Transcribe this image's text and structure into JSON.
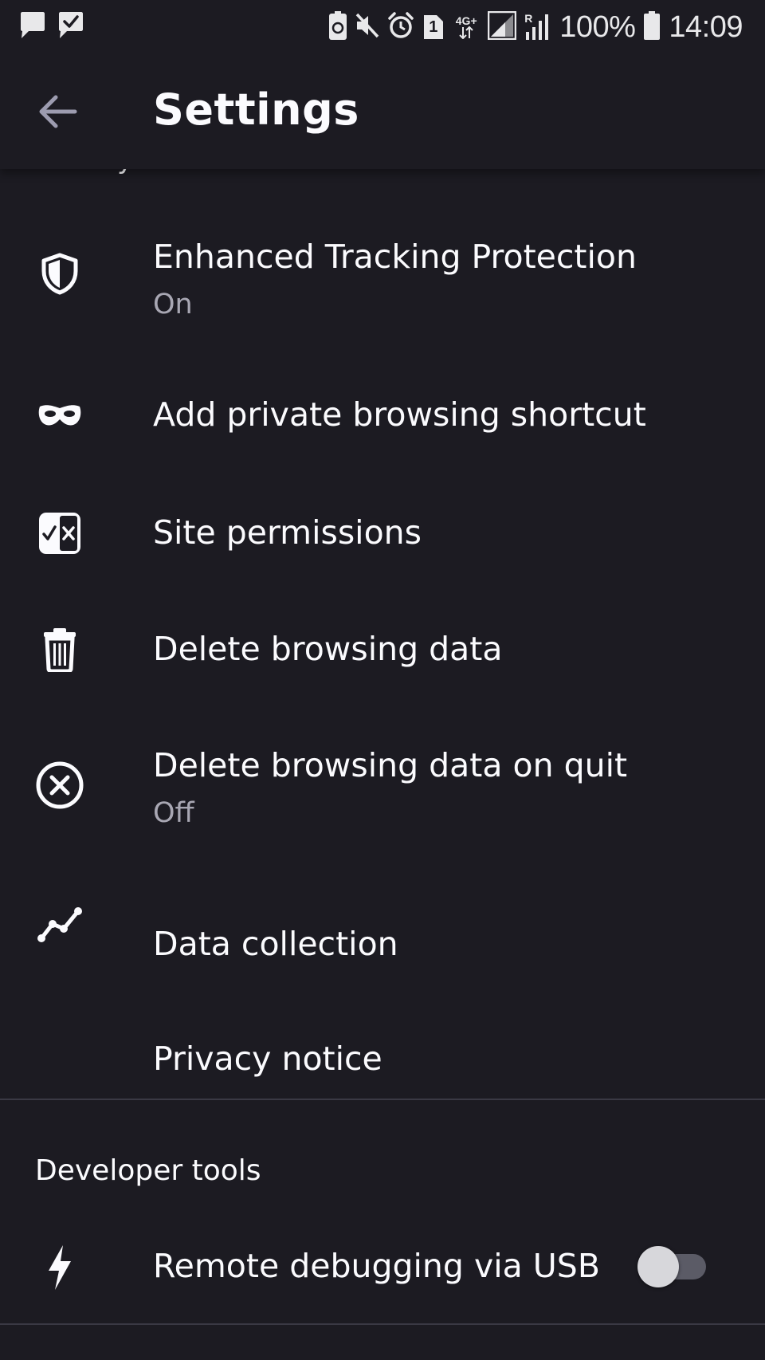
{
  "status_bar": {
    "icons_left": [
      "chat-notification-icon",
      "message-check-icon"
    ],
    "icons_right": [
      "battery-saver-icon",
      "mute-icon",
      "alarm-icon",
      "sim-1-icon",
      "network-4g-icon",
      "signal-icon",
      "roaming-signal-icon"
    ],
    "network_label": "4G+",
    "roaming_label": "R",
    "sim_label": "1",
    "battery_percent": "100%",
    "time": "14:09"
  },
  "app_bar": {
    "back_icon": "arrow-back-icon",
    "title": "Settings"
  },
  "privacy_section": {
    "partial_header": "Privacy",
    "items": [
      {
        "icon": "shield-icon",
        "title": "Enhanced Tracking Protection",
        "subtitle": "On"
      },
      {
        "icon": "private-mask-icon",
        "title": "Add private browsing shortcut"
      },
      {
        "icon": "site-permissions-icon",
        "title": "Site permissions"
      },
      {
        "icon": "trash-icon",
        "title": "Delete browsing data"
      },
      {
        "icon": "circle-close-icon",
        "title": "Delete browsing data on quit",
        "subtitle": "Off"
      },
      {
        "icon": "data-collection-icon",
        "title": "Data collection"
      },
      {
        "title": "Privacy notice"
      }
    ]
  },
  "developer_section": {
    "header": "Developer tools",
    "items": [
      {
        "icon": "lightning-icon",
        "title": "Remote debugging via USB",
        "toggle_on": false
      }
    ]
  },
  "colors": {
    "background": "#1c1b22",
    "text_primary": "#fbfbfe",
    "text_secondary": "#a8a7b3",
    "divider": "#3a3944",
    "back_arrow": "#9d9cb0"
  }
}
